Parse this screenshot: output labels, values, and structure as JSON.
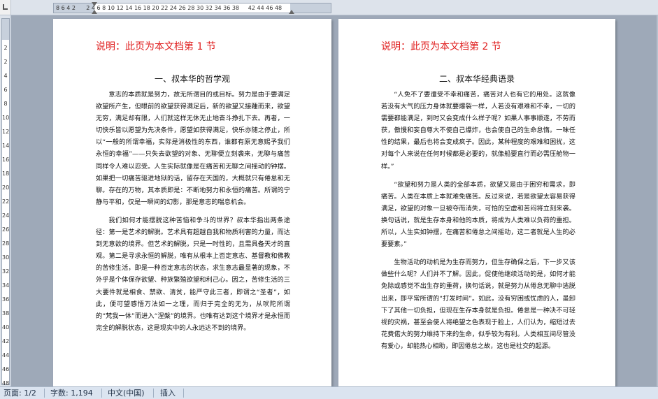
{
  "ruler": {
    "horizontal_numbers": "8  6  4  2        2  4  6  8 10 12 14 16 18 20 22 24 26 28 30 32 34 36 38      42 44 46 48",
    "vertical_numbers": [
      "2",
      "2",
      "4",
      "6",
      "8",
      "10",
      "12",
      "14",
      "16",
      "18",
      "20",
      "22",
      "24",
      "26",
      "28",
      "30",
      "32",
      "34",
      "36",
      "38",
      "40",
      "42",
      "44",
      "46",
      "48"
    ]
  },
  "page1": {
    "note": "说明：此页为本文档第 1 节",
    "heading": "一、叔本华的哲学观",
    "paragraphs": [
      "意志的本质就是努力，故无所谓目的或目标。努力是由于要满足欲望所产生，但眼前的欲望获得满足后，新的欲望又接踵而来，欲望无穷，满足却有限，人们就这样无休无止地奋斗挣扎下去。再者，一切快乐皆以愿望为先决条件，愿望如获得满足，快乐亦随之停止，所以“一般的所谓幸福，实际是消极性的东西，谁都有原无意赐予我们永恒的幸福”——只失去欲望的对象、无聊便立刻袭来，无聊与痛苦同样令人难以忍受。人生实际就像是在痛苦和无聊之间摇动的钟摆。如果把一切痛苦驱进地狱的话，留存在天国的，大概就只有倦怠和无聊。存在的万物，其本质即是：不断地努力和永恒的痛苦。所谓的宁静与平和，仅是一瞬间的幻影，那是意志的喘息机会。",
      "我们如何才能摆脱这种苦恼和争斗的世界？叔本华指出两条途径：第一是艺术的解脱。艺术具有超越自我和物质利害的力量，而达到无意欲的境界。但艺术的解脱，只是一时性的，且需具备天才的直观。第二是寻求永恒的解脱，唯有从根本上否定意志、基督教和佛教的苦修生活，即是一种否定意志的状态，求生意志最显著的现象，不外乎是个体保存欲望、种族繁殖欲望和利己心。因之，苦修生活的三大要件就是相食、禁欲、清贫，能严守此三者，即谓之“圣者”，如此，便可望感悟万法如一之理，而归于完全的无为，从吠陀所谓的“梵我一体”而进入“涅槃”的境界。也唯有达到这个境界才是永恒而完全的解脱状态，这是现实中的人永远达不到的境界。"
    ]
  },
  "page2": {
    "note": "说明：此页为本文档第 2 节",
    "heading": "二、叔本华经典语录",
    "paragraphs": [
      "“人免不了要遭受不幸和痛苦，痛苦对人也有它的用处。这就像若没有大气的压力身体就要爆裂一样，人若没有艰难和不幸，一切的需要都能满足，到时又会变成什么样子呢？如果人事事顺遂，不劳而获，傲慢和妄自尊大不使自己爆炸，也会使自己的生命怠惰。一味任性的结果，最后也将会变成疯子。因此，某种程度的艰难和困扰，这对每个人来说在任何时候都是必要的，就像船要直行而必需压舱物一样。”",
      "“欲望和努力是人类的全部本质，欲望又是由于困穷和需求，即痛苦。人类在本质上本就难免痛苦。反过来说，若是欲望太容易获得满足，欲望的对象一旦被夺而消失，可怕的空虚和苦闷将立刻来袭。换句话说，就是生存本身和他的本质，将成为人类难以负荷的重担。所以，人生实如钟摆，在痛苦和倦怠之间摇动，这二者就是人生的必要要素。”",
      "生物活动的动机是为生存而努力，但生存确保之后，下一步又该做些什么呢？人们并不了解。因此，促使他继续活动的是，如何才能免除或感觉不出生存的重荷，换句话说，就是努力从倦怠无聊中逃脱出来，即平常所谓的“打发时间”。如此，没有穷困或忧虑的人，虽卸下了其他一切负担，但现在生存本身就是负担。倦怠是一种决不可轻视的灾祸，甚至会使人将绝望之色表现于脸上，人们认为，缩短过去花费偌大的努力维持下来的生命，似乎较为有利。人类相互间尽管没有爱心，却能热心相助，即因倦怠之故，这也是社交的起源。"
    ]
  },
  "statusbar": {
    "page": "页面: 1/2",
    "words": "字数: 1,194",
    "language": "中文(中国)",
    "mode": "插入"
  },
  "colors": {
    "note_red": "#e02020",
    "workspace": "#9ea9b8",
    "statusbar": "#dbe4f0"
  }
}
